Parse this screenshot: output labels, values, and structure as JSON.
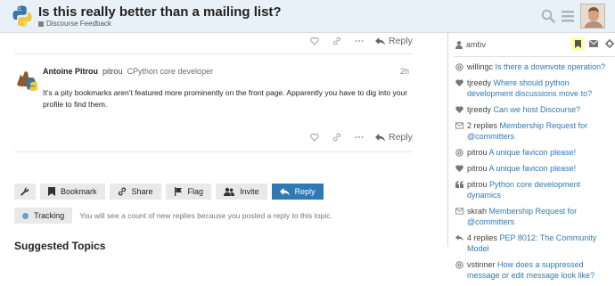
{
  "header": {
    "title": "Is this really better than a mailing list?",
    "category": "Discourse Feedback",
    "category_color": "#808281"
  },
  "prev_post_actions": {
    "reply_label": "Reply"
  },
  "post": {
    "full_name": "Antoine Pitrou",
    "username": "pitrou",
    "user_title": "CPython core developer",
    "date": "2h",
    "body": "It’s a pity bookmarks aren’t featured more prominently on the front page. Apparently you have to dig into your profile to find them.",
    "reply_label": "Reply"
  },
  "controls": {
    "bookmark": "Bookmark",
    "share": "Share",
    "flag": "Flag",
    "invite": "Invite",
    "reply": "Reply"
  },
  "tracking": {
    "label": "Tracking",
    "message": "You will see a count of new replies because you posted a reply to this topic."
  },
  "suggested_title": "Suggested Topics",
  "sidebar": {
    "username": "ambv",
    "notifications": [
      {
        "icon": "at-icon",
        "who": "willingc",
        "what": "Is there a downvote operation?"
      },
      {
        "icon": "heart-icon",
        "who": "tjreedy",
        "what": "Where should python development discussions move to?"
      },
      {
        "icon": "heart-icon",
        "who": "tjreedy",
        "what": "Can we host Discourse?"
      },
      {
        "icon": "envelope-icon",
        "who": "2 replies",
        "what": "Membership Request for @committers"
      },
      {
        "icon": "at-icon",
        "who": "pitrou",
        "what": "A unique favicon please!"
      },
      {
        "icon": "heart-icon",
        "who": "pitrou",
        "what": "A unique favicon please!"
      },
      {
        "icon": "quote-icon",
        "who": "pitrou",
        "what": "Python core development dynamics"
      },
      {
        "icon": "envelope-icon",
        "who": "skrah",
        "what": "Membership Request for @committers"
      },
      {
        "icon": "reply-icon",
        "who": "4 replies",
        "what": "PEP 8012: The Community Model"
      },
      {
        "icon": "at-icon",
        "who": "vstinner",
        "what": "How does a suppressed message or edit message look like?"
      }
    ]
  },
  "colors": {
    "accent": "#2f79b7",
    "header_bg": "#e8f1f8",
    "bookmark_highlight": "#ffff9c"
  }
}
